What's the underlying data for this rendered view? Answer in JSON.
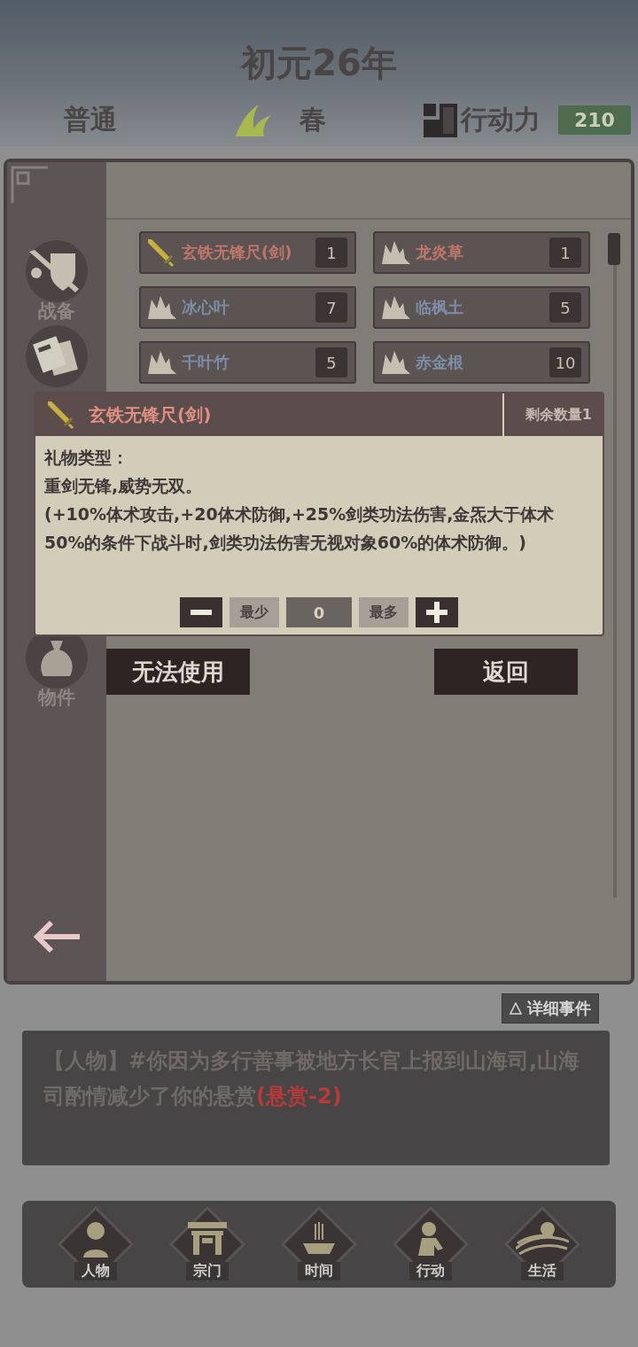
{
  "header": {
    "title": "初元26年",
    "difficulty": "普通",
    "season": "春",
    "action_label": "行动力",
    "action_points": "210"
  },
  "sidebar": {
    "tabs": [
      {
        "label": "战备",
        "kind": "gear"
      },
      {
        "kind": "cards"
      },
      {
        "label": "物件",
        "kind": "bag"
      }
    ]
  },
  "items": [
    {
      "name": "玄铁无锋尺(剑)",
      "count": "1",
      "kind": "sword",
      "color": "#c0766a"
    },
    {
      "name": "龙炎草",
      "count": "1",
      "kind": "herb",
      "color": "#c0766a"
    },
    {
      "name": "冰心叶",
      "count": "7",
      "kind": "herb",
      "color": "#7c8ea8"
    },
    {
      "name": "临枫土",
      "count": "5",
      "kind": "herb",
      "color": "#7c8ea8"
    },
    {
      "name": "千叶竹",
      "count": "5",
      "kind": "herb",
      "color": "#7c8ea8"
    },
    {
      "name": "赤金根",
      "count": "10",
      "kind": "herb",
      "color": "#7c8ea8"
    }
  ],
  "dialog": {
    "title": "玄铁无锋尺(剑)",
    "remaining": "剩余数量1",
    "lines": [
      "礼物类型：",
      "重剑无锋,威势无双。",
      "(+10%体术攻击,+20体术防御,+25%剑类功法伤害,金炁大于体术50%的条件下战斗时,剑类功法伤害无视对象60%的体术防御。)"
    ],
    "min_label": "最少",
    "value": "0",
    "max_label": "最多"
  },
  "actions": [
    "无法使用",
    "返回"
  ],
  "details_button": "详细事件",
  "event_log": {
    "text": "【人物】#你因为多行善事被地方长官上报到山海司,山海司酌情减少了你的悬赏",
    "highlight": "(悬赏-2)"
  },
  "nav": [
    {
      "label": "人物",
      "kind": "person"
    },
    {
      "label": "宗门",
      "kind": "gate"
    },
    {
      "label": "时间",
      "kind": "incense"
    },
    {
      "label": "行动",
      "kind": "action"
    },
    {
      "label": "生活",
      "kind": "life"
    }
  ]
}
